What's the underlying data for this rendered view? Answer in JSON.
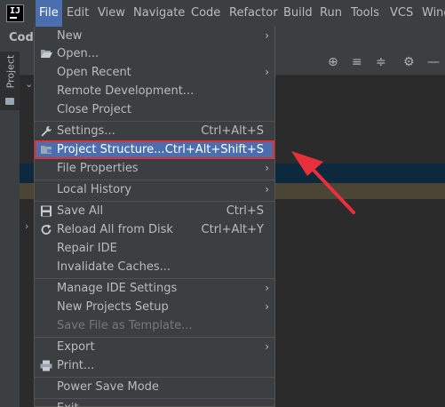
{
  "menubar": {
    "logo_text": "IJ",
    "items": [
      "File",
      "Edit",
      "View",
      "Navigate",
      "Code",
      "Refactor",
      "Build",
      "Run",
      "Tools",
      "VCS",
      "Window"
    ]
  },
  "breadcrumb": "Code",
  "sidebar": {
    "project_tab": "Project"
  },
  "file_menu": {
    "items": [
      {
        "label": "New",
        "shortcut": "",
        "submenu": true
      },
      {
        "label": "Open...",
        "shortcut": "",
        "submenu": false
      },
      {
        "label": "Open Recent",
        "shortcut": "",
        "submenu": true
      },
      {
        "label": "Remote Development...",
        "shortcut": "",
        "submenu": false
      },
      {
        "label": "Close Project",
        "shortcut": "",
        "submenu": false
      },
      {
        "label": "Settings...",
        "shortcut": "Ctrl+Alt+S",
        "submenu": false
      },
      {
        "label": "Project Structure...",
        "shortcut": "Ctrl+Alt+Shift+S",
        "submenu": false,
        "selected": true
      },
      {
        "label": "File Properties",
        "shortcut": "",
        "submenu": true
      },
      {
        "label": "Local History",
        "shortcut": "",
        "submenu": true
      },
      {
        "label": "Save All",
        "shortcut": "Ctrl+S",
        "submenu": false
      },
      {
        "label": "Reload All from Disk",
        "shortcut": "Ctrl+Alt+Y",
        "submenu": false
      },
      {
        "label": "Repair IDE",
        "shortcut": "",
        "submenu": false
      },
      {
        "label": "Invalidate Caches...",
        "shortcut": "",
        "submenu": false
      },
      {
        "label": "Manage IDE Settings",
        "shortcut": "",
        "submenu": true
      },
      {
        "label": "New Projects Setup",
        "shortcut": "",
        "submenu": true
      },
      {
        "label": "Save File as Template...",
        "shortcut": "",
        "submenu": false,
        "disabled": true
      },
      {
        "label": "Export",
        "shortcut": "",
        "submenu": true
      },
      {
        "label": "Print...",
        "shortcut": "",
        "submenu": false
      },
      {
        "label": "Power Save Mode",
        "shortcut": "",
        "submenu": false
      },
      {
        "label": "Exit",
        "shortcut": "",
        "submenu": false
      }
    ]
  },
  "colors": {
    "accent": "#4b6eaf",
    "highlight_border": "#e0303a",
    "annotation_arrow": "#e8303a"
  }
}
